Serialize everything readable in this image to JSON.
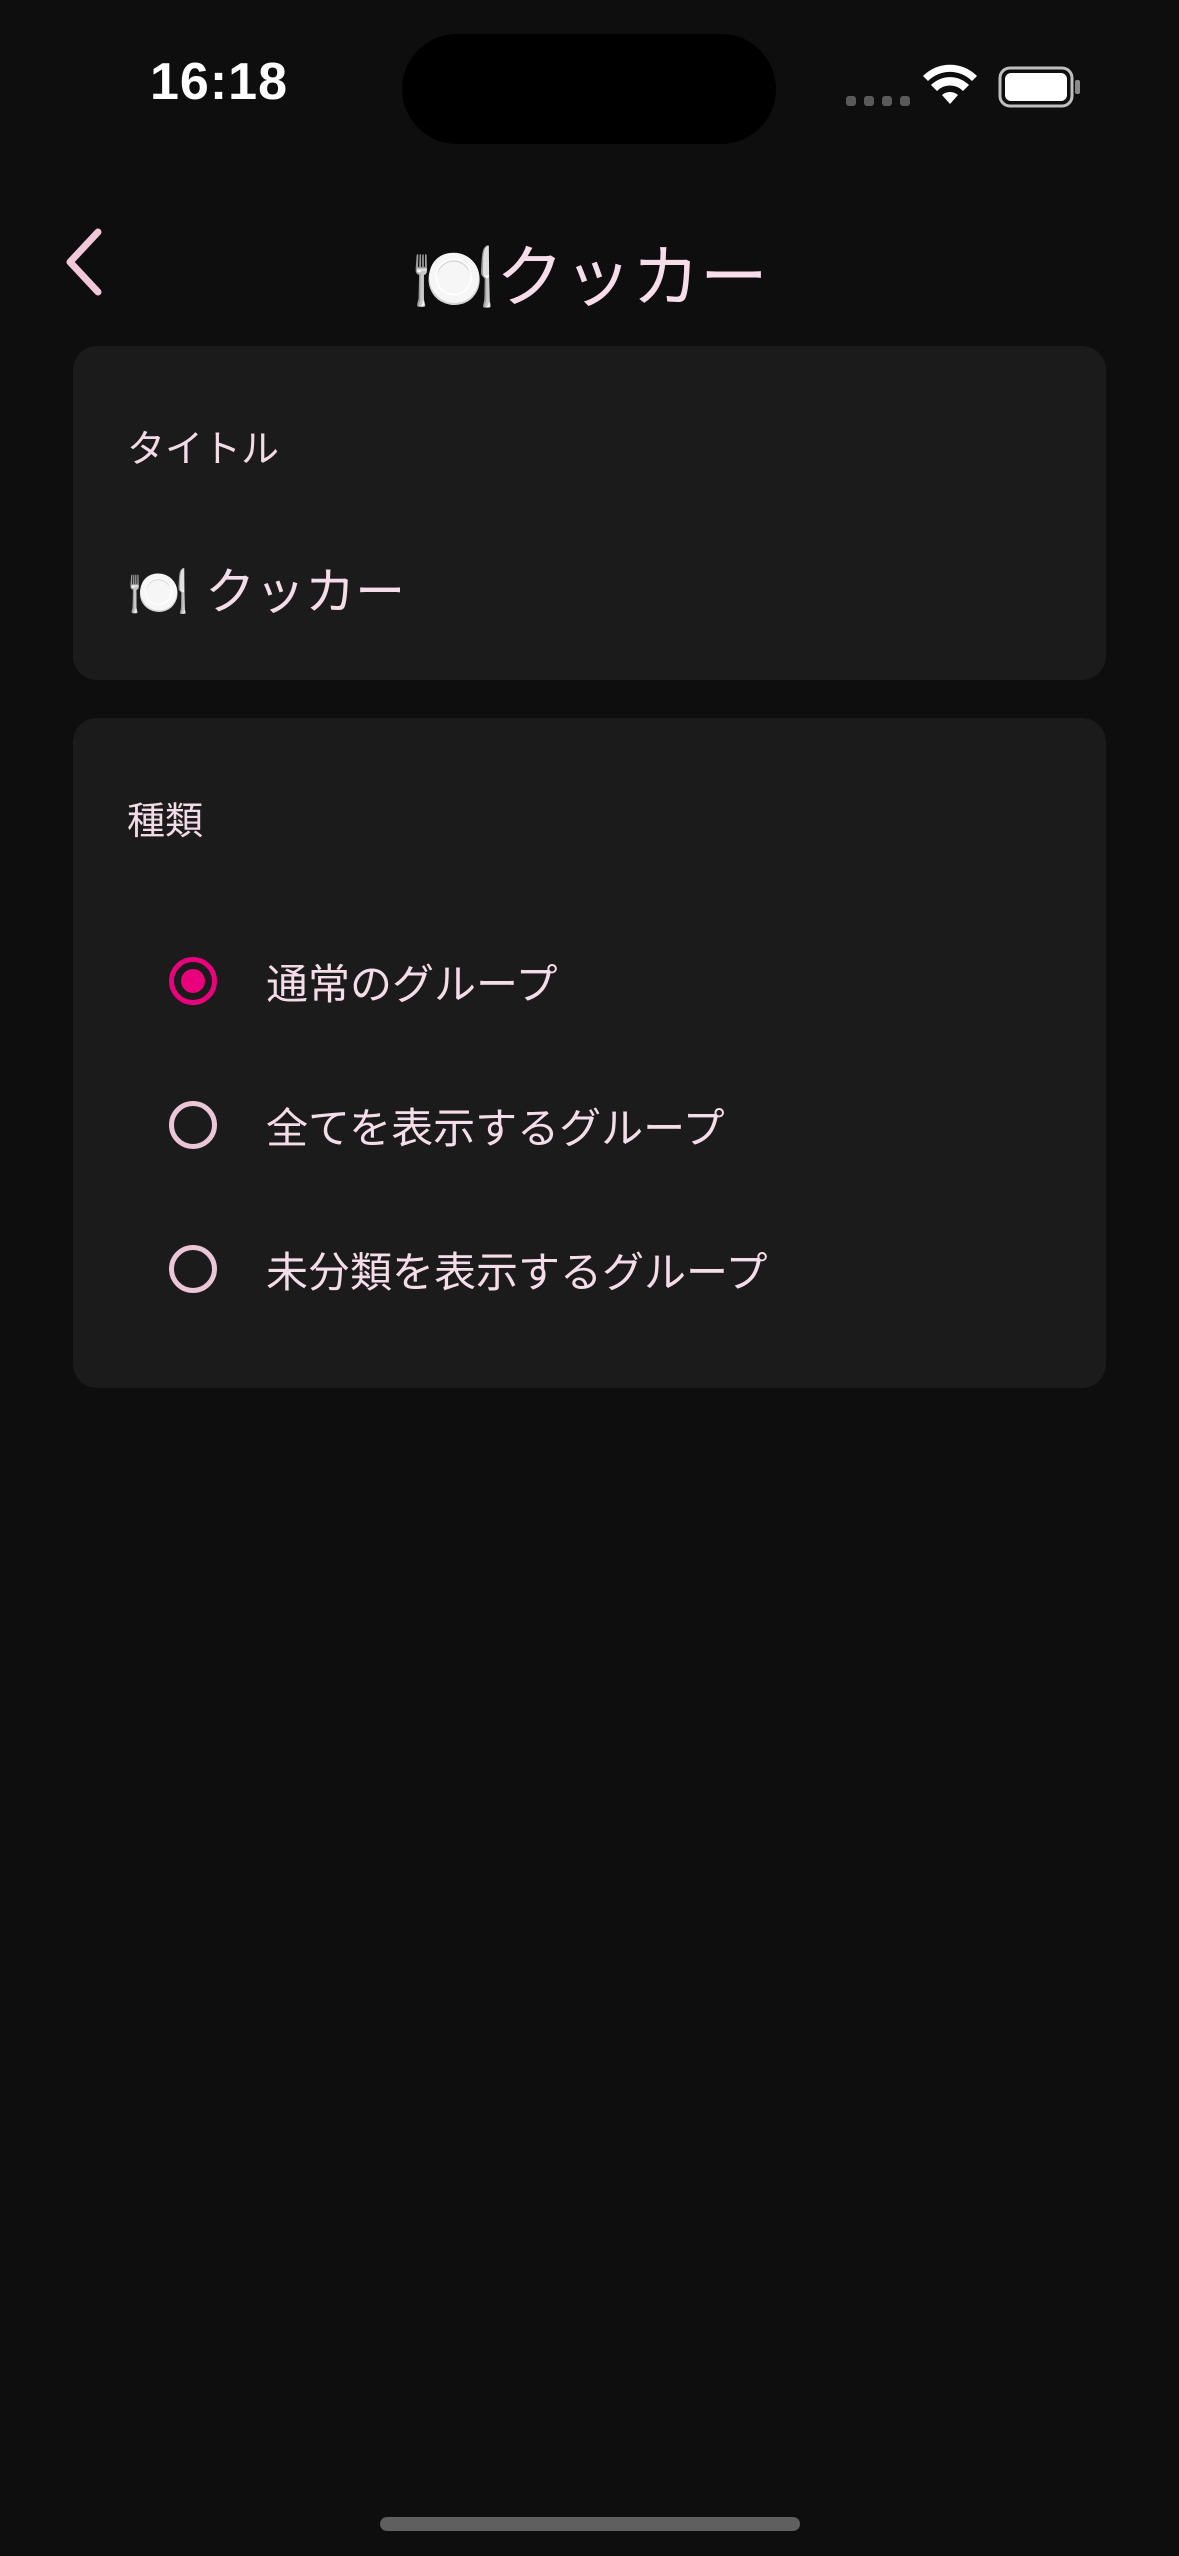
{
  "status_bar": {
    "time": "16:18"
  },
  "nav": {
    "back_icon": "chevron-left-icon",
    "title": "🍽️クッカー"
  },
  "title_section": {
    "label": "タイトル",
    "value": "🍽️ クッカー"
  },
  "type_section": {
    "label": "種類",
    "options": [
      {
        "label": "通常のグループ",
        "selected": true
      },
      {
        "label": "全てを表示するグループ",
        "selected": false
      },
      {
        "label": "未分類を表示するグループ",
        "selected": false
      }
    ]
  },
  "colors": {
    "background": "#0e0e0e",
    "card": "#1c1b1c",
    "accent": "#e8007d",
    "text": "#f5dde7"
  }
}
